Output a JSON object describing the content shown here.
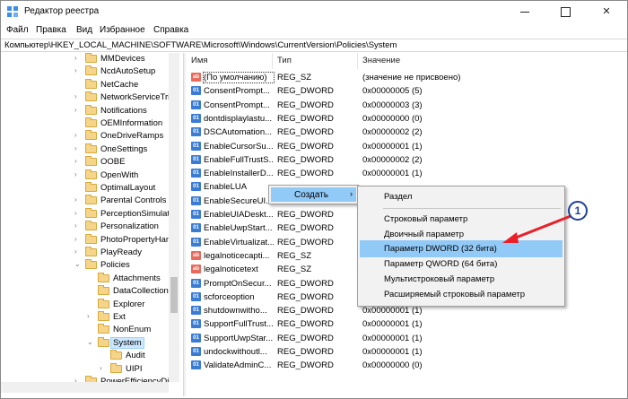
{
  "window": {
    "title": "Редактор реестра",
    "controls": {
      "minimize": "",
      "maximize": "",
      "close": "✕"
    }
  },
  "menu": [
    "Файл",
    "Правка",
    "Вид",
    "Избранное",
    "Справка"
  ],
  "address": "Компьютер\\HKEY_LOCAL_MACHINE\\SOFTWARE\\Microsoft\\Windows\\CurrentVersion\\Policies\\System",
  "tree": {
    "items": [
      {
        "label": "MMDevices",
        "expander": "›"
      },
      {
        "label": "NcdAutoSetup",
        "expander": "›"
      },
      {
        "label": "NetCache",
        "expander": ""
      },
      {
        "label": "NetworkServiceTrig",
        "expander": "›"
      },
      {
        "label": "Notifications",
        "expander": "›"
      },
      {
        "label": "OEMInformation",
        "expander": ""
      },
      {
        "label": "OneDriveRamps",
        "expander": "›"
      },
      {
        "label": "OneSettings",
        "expander": "›"
      },
      {
        "label": "OOBE",
        "expander": "›"
      },
      {
        "label": "OpenWith",
        "expander": "›"
      },
      {
        "label": "OptimalLayout",
        "expander": ""
      },
      {
        "label": "Parental Controls",
        "expander": "›"
      },
      {
        "label": "PerceptionSimulati",
        "expander": "›"
      },
      {
        "label": "Personalization",
        "expander": "›"
      },
      {
        "label": "PhotoPropertyHan",
        "expander": "›"
      },
      {
        "label": "PlayReady",
        "expander": "›"
      },
      {
        "label": "Policies",
        "expander": "⌄"
      },
      {
        "label": "Attachments",
        "expander": ""
      },
      {
        "label": "DataCollection",
        "expander": ""
      },
      {
        "label": "Explorer",
        "expander": ""
      },
      {
        "label": "Ext",
        "expander": "›"
      },
      {
        "label": "NonEnum",
        "expander": ""
      },
      {
        "label": "System",
        "expander": "⌄"
      },
      {
        "label": "Audit",
        "expander": ""
      },
      {
        "label": "UIPI",
        "expander": "›"
      },
      {
        "label": "PowerEfficiencyDi",
        "expander": "›"
      }
    ],
    "selected": "System"
  },
  "list": {
    "headers": [
      "Имя",
      "Тип",
      "Значение"
    ],
    "rows": [
      {
        "icon": "string-value-icon",
        "badge": "ab",
        "name": "(По умолчанию)",
        "type": "REG_SZ",
        "value": "(значение не присвоено)"
      },
      {
        "icon": "dword-value-icon",
        "badge": "01",
        "name": "ConsentPrompt...",
        "type": "REG_DWORD",
        "value": "0x00000005 (5)"
      },
      {
        "icon": "dword-value-icon",
        "badge": "01",
        "name": "ConsentPrompt...",
        "type": "REG_DWORD",
        "value": "0x00000003 (3)"
      },
      {
        "icon": "dword-value-icon",
        "badge": "01",
        "name": "dontdisplaylastu...",
        "type": "REG_DWORD",
        "value": "0x00000000 (0)"
      },
      {
        "icon": "dword-value-icon",
        "badge": "01",
        "name": "DSCAutomation...",
        "type": "REG_DWORD",
        "value": "0x00000002 (2)"
      },
      {
        "icon": "dword-value-icon",
        "badge": "01",
        "name": "EnableCursorSu...",
        "type": "REG_DWORD",
        "value": "0x00000001 (1)"
      },
      {
        "icon": "dword-value-icon",
        "badge": "01",
        "name": "EnableFullTrustS...",
        "type": "REG_DWORD",
        "value": "0x00000002 (2)"
      },
      {
        "icon": "dword-value-icon",
        "badge": "01",
        "name": "EnableInstallerD...",
        "type": "REG_DWORD",
        "value": "0x00000001 (1)"
      },
      {
        "icon": "dword-value-icon",
        "badge": "01",
        "name": "EnableLUA",
        "type": "",
        "value": ""
      },
      {
        "icon": "dword-value-icon",
        "badge": "01",
        "name": "EnableSecureUI...",
        "type": "",
        "value": ""
      },
      {
        "icon": "dword-value-icon",
        "badge": "01",
        "name": "EnableUIADeskt...",
        "type": "REG_DWORD",
        "value": ""
      },
      {
        "icon": "dword-value-icon",
        "badge": "01",
        "name": "EnableUwpStart...",
        "type": "REG_DWORD",
        "value": ""
      },
      {
        "icon": "dword-value-icon",
        "badge": "01",
        "name": "EnableVirtualizat...",
        "type": "REG_DWORD",
        "value": ""
      },
      {
        "icon": "string-value-icon",
        "badge": "ab",
        "name": "legalnoticecapti...",
        "type": "REG_SZ",
        "value": ""
      },
      {
        "icon": "string-value-icon",
        "badge": "ab",
        "name": "legalnoticetext",
        "type": "REG_SZ",
        "value": ""
      },
      {
        "icon": "dword-value-icon",
        "badge": "01",
        "name": "PromptOnSecur...",
        "type": "REG_DWORD",
        "value": ""
      },
      {
        "icon": "dword-value-icon",
        "badge": "01",
        "name": "scforceoption",
        "type": "REG_DWORD",
        "value": ""
      },
      {
        "icon": "dword-value-icon",
        "badge": "01",
        "name": "shutdownwitho...",
        "type": "REG_DWORD",
        "value": "0x00000001 (1)"
      },
      {
        "icon": "dword-value-icon",
        "badge": "01",
        "name": "SupportFullTrust...",
        "type": "REG_DWORD",
        "value": "0x00000001 (1)"
      },
      {
        "icon": "dword-value-icon",
        "badge": "01",
        "name": "SupportUwpStar...",
        "type": "REG_DWORD",
        "value": "0x00000001 (1)"
      },
      {
        "icon": "dword-value-icon",
        "badge": "01",
        "name": "undockwithoutl...",
        "type": "REG_DWORD",
        "value": "0x00000001 (1)"
      },
      {
        "icon": "dword-value-icon",
        "badge": "01",
        "name": "ValidateAdminC...",
        "type": "REG_DWORD",
        "value": "0x00000000 (0)"
      }
    ]
  },
  "context_menu": {
    "create": "Создать",
    "create_arrow": "›",
    "submenu": {
      "key": "Раздел",
      "string": "Строковый параметр",
      "binary": "Двоичный параметр",
      "dword": "Параметр DWORD (32 бита)",
      "qword": "Параметр QWORD (64 бита)",
      "multistring": "Мультистроковый параметр",
      "expandstring": "Расширяемый строковый параметр"
    },
    "highlighted": "Параметр DWORD (32 бита)"
  },
  "annotation": {
    "badge": "1",
    "color": "#e8202a",
    "badge_color": "#1f3fa0"
  },
  "colors": {
    "highlight": "#91c9f7",
    "selection": "#cce8ff"
  }
}
